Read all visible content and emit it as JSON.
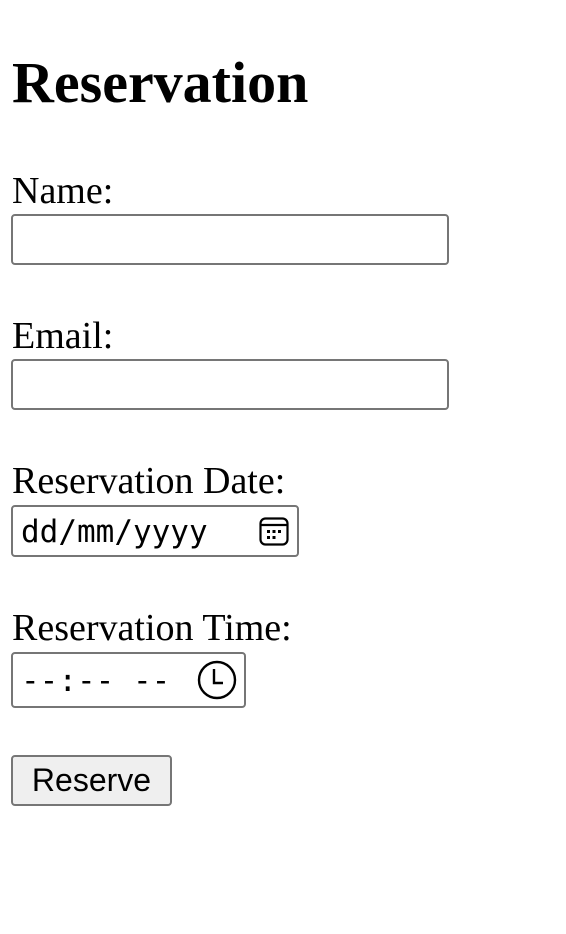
{
  "page": {
    "title": "Reservation"
  },
  "form": {
    "name": {
      "label": "Name:",
      "value": ""
    },
    "email": {
      "label": "Email:",
      "value": ""
    },
    "date": {
      "label": "Reservation Date:",
      "placeholder": "dd/mm/yyyy",
      "icon": "calendar-icon"
    },
    "time": {
      "label": "Reservation Time:",
      "placeholder": "--:-- --",
      "icon": "clock-icon"
    },
    "submit_label": "Reserve"
  },
  "colors": {
    "border": "#767676",
    "button_background": "#efefef",
    "text": "#000000",
    "page_background": "#ffffff"
  }
}
